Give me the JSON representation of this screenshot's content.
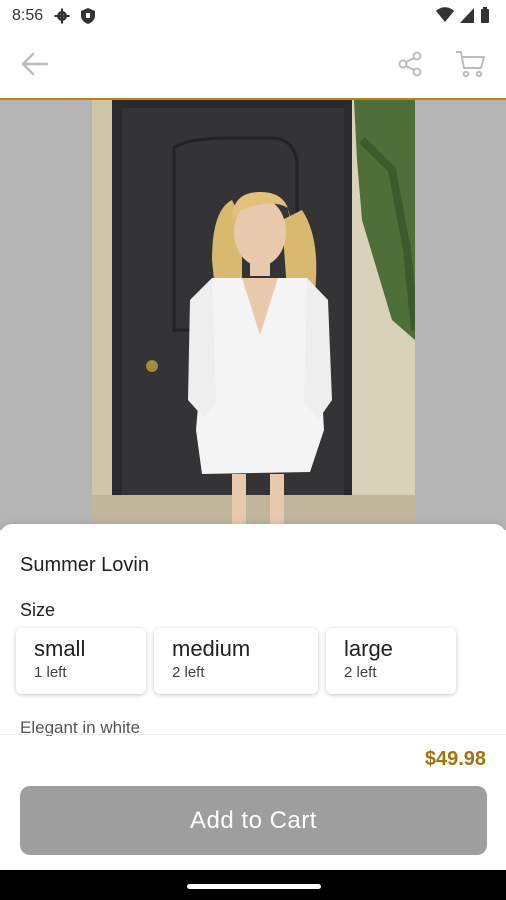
{
  "status_bar": {
    "time": "8:56",
    "icons": [
      "settings-gear-icon",
      "shield-icon",
      "wifi-icon",
      "signal-icon",
      "battery-icon"
    ]
  },
  "app_bar": {
    "back_icon": "arrow-left-icon",
    "share_icon": "share-icon",
    "cart_icon": "cart-icon",
    "accent_color": "#b8860b"
  },
  "product": {
    "title": "Summer Lovin",
    "size_heading": "Size",
    "sizes": [
      {
        "name": "small",
        "stock": "1 left"
      },
      {
        "name": "medium",
        "stock": "2 left"
      },
      {
        "name": "large",
        "stock": "2 left"
      }
    ],
    "description": "Elegant in white",
    "price": "$49.98",
    "price_color": "#a0740e"
  },
  "actions": {
    "add_to_cart": "Add to Cart",
    "button_color": "#9e9e9e"
  }
}
